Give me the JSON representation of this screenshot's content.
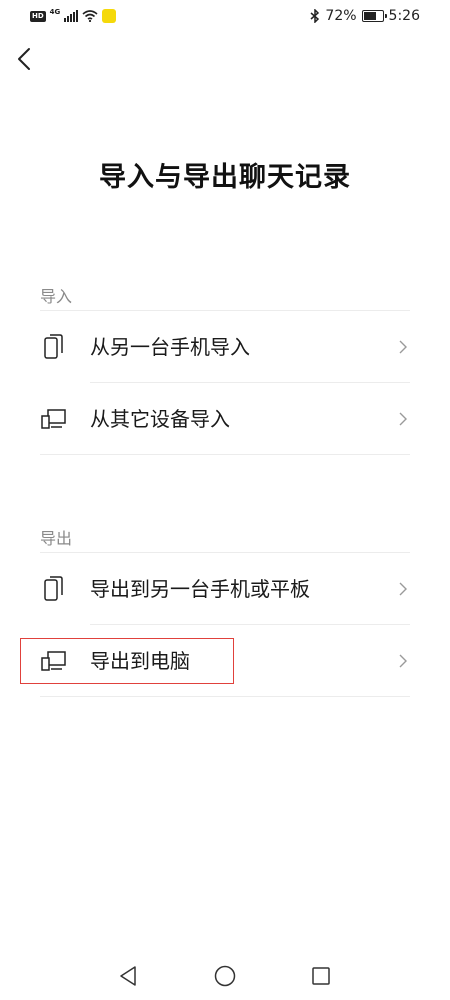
{
  "status_bar": {
    "hd_label": "HD",
    "network_label": "4G",
    "battery_percent": "72%",
    "battery_level": 0.72,
    "time": "5:26"
  },
  "header": {
    "back_icon": "chevron-left-icon"
  },
  "title": "导入与导出聊天记录",
  "import_section": {
    "header": "导入",
    "items": [
      {
        "label": "从另一台手机导入",
        "icon": "phone-icon"
      },
      {
        "label": "从其它设备导入",
        "icon": "devices-icon"
      }
    ]
  },
  "export_section": {
    "header": "导出",
    "items": [
      {
        "label": "导出到另一台手机或平板",
        "icon": "phone-icon"
      },
      {
        "label": "导出到电脑",
        "icon": "devices-icon"
      }
    ]
  },
  "colors": {
    "highlight": "#e0413c",
    "secondary_text": "#8a8a8a",
    "divider": "#ececec"
  },
  "nav_bar": {
    "icons": [
      "back-triangle-icon",
      "home-circle-icon",
      "recents-square-icon"
    ]
  }
}
